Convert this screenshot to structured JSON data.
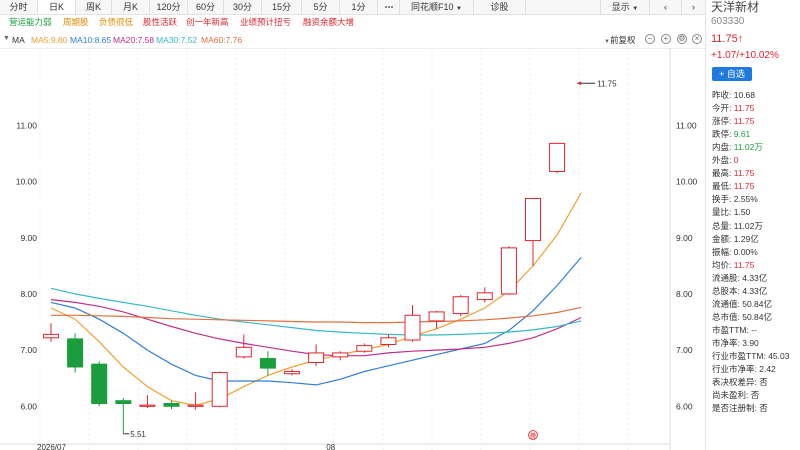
{
  "topbar": {
    "tabs": [
      "分时",
      "日K",
      "周K",
      "月K",
      "120分",
      "60分",
      "30分",
      "15分",
      "5分",
      "1分"
    ],
    "active_tab": "日K",
    "more_icon": "more-dots-icon",
    "f10": "同花顺F10",
    "diagnose": "诊股",
    "show": "显示"
  },
  "tags": [
    {
      "label": "营运能力弱",
      "color": "#1a9e3d"
    },
    {
      "label": "周期股",
      "color": "#e08a00"
    },
    {
      "label": "负债很低",
      "color": "#e08a00"
    },
    {
      "label": "股性活跃",
      "color": "#e0242d"
    },
    {
      "label": "创一年新高",
      "color": "#e0242d"
    },
    {
      "label": "业绩预计扭亏",
      "color": "#e0242d"
    },
    {
      "label": "融资余额大增",
      "color": "#e0242d"
    }
  ],
  "ma_row": {
    "ma": "MA",
    "ma5": "MA5:9.80",
    "ma10": "MA10:8.65",
    "ma20": "MA20:7.58",
    "ma30": "MA30:7.52",
    "ma60": "MA60:7.76",
    "adjust": "前复权",
    "colors": {
      "ma5": "#f0a030",
      "ma10": "#2f7fd6",
      "ma20": "#c0308a",
      "ma30": "#38b8c8",
      "ma60": "#e07040"
    }
  },
  "chart_data": {
    "type": "candlestick",
    "y_ticks": [
      "11.00",
      "10.00",
      "9.00",
      "8.00",
      "7.00",
      "6.00"
    ],
    "ylim": [
      5.4,
      12.2
    ],
    "x_labels": [
      {
        "index": 0,
        "label": "2026/07"
      },
      {
        "index": 12,
        "label": "08"
      }
    ],
    "candles": [
      {
        "open": 7.22,
        "close": 7.28,
        "high": 7.48,
        "low": 7.15
      },
      {
        "open": 7.2,
        "close": 6.7,
        "high": 7.3,
        "low": 6.6
      },
      {
        "open": 6.75,
        "close": 6.05,
        "high": 6.8,
        "low": 6.0
      },
      {
        "open": 6.1,
        "close": 6.05,
        "high": 6.15,
        "low": 5.51
      },
      {
        "open": 6.0,
        "close": 6.02,
        "high": 6.2,
        "low": 5.97
      },
      {
        "open": 6.05,
        "close": 6.0,
        "high": 6.1,
        "low": 5.95
      },
      {
        "open": 6.0,
        "close": 6.02,
        "high": 6.25,
        "low": 5.94
      },
      {
        "open": 6.0,
        "close": 6.6,
        "high": 6.62,
        "low": 5.98
      },
      {
        "open": 6.88,
        "close": 7.05,
        "high": 7.28,
        "low": 6.85
      },
      {
        "open": 6.85,
        "close": 6.68,
        "high": 6.98,
        "low": 6.55
      },
      {
        "open": 6.58,
        "close": 6.62,
        "high": 6.66,
        "low": 6.55
      },
      {
        "open": 6.78,
        "close": 6.95,
        "high": 7.1,
        "low": 6.72
      },
      {
        "open": 6.88,
        "close": 6.95,
        "high": 6.98,
        "low": 6.82
      },
      {
        "open": 6.98,
        "close": 7.08,
        "high": 7.12,
        "low": 6.95
      },
      {
        "open": 7.1,
        "close": 7.22,
        "high": 7.28,
        "low": 7.05
      },
      {
        "open": 7.18,
        "close": 7.62,
        "high": 7.8,
        "low": 7.15
      },
      {
        "open": 7.52,
        "close": 7.68,
        "high": 7.7,
        "low": 7.38
      },
      {
        "open": 7.65,
        "close": 7.95,
        "high": 7.98,
        "low": 7.6
      },
      {
        "open": 7.9,
        "close": 8.02,
        "high": 8.12,
        "low": 7.85
      },
      {
        "open": 8.0,
        "close": 8.82,
        "high": 8.85,
        "low": 7.98
      },
      {
        "open": 8.95,
        "close": 9.7,
        "high": 9.7,
        "low": 8.5
      },
      {
        "open": 10.18,
        "close": 10.68,
        "high": 10.68,
        "low": 10.15
      }
    ],
    "series": [
      {
        "name": "MA5",
        "color": "#f0a030",
        "values": [
          7.75,
          7.55,
          7.15,
          6.7,
          6.35,
          6.1,
          6.02,
          6.13,
          6.35,
          6.55,
          6.7,
          6.82,
          6.92,
          7.01,
          7.1,
          7.25,
          7.38,
          7.55,
          7.75,
          8.05,
          8.5,
          9.05,
          9.8
        ]
      },
      {
        "name": "MA10",
        "color": "#2f7fd6",
        "values": [
          7.85,
          7.75,
          7.55,
          7.3,
          7.0,
          6.75,
          6.55,
          6.45,
          6.45,
          6.45,
          6.42,
          6.38,
          6.48,
          6.62,
          6.72,
          6.82,
          6.92,
          7.02,
          7.12,
          7.35,
          7.7,
          8.15,
          8.65
        ]
      },
      {
        "name": "MA20",
        "color": "#c0308a",
        "values": [
          7.9,
          7.85,
          7.78,
          7.68,
          7.55,
          7.42,
          7.3,
          7.2,
          7.12,
          7.05,
          6.98,
          6.92,
          6.9,
          6.9,
          6.95,
          6.98,
          7.0,
          7.02,
          7.05,
          7.12,
          7.22,
          7.38,
          7.58
        ]
      },
      {
        "name": "MA30",
        "color": "#38b8c8",
        "values": [
          8.1,
          8.0,
          7.92,
          7.85,
          7.78,
          7.7,
          7.62,
          7.55,
          7.5,
          7.45,
          7.4,
          7.35,
          7.32,
          7.3,
          7.28,
          7.27,
          7.27,
          7.28,
          7.3,
          7.32,
          7.36,
          7.42,
          7.52
        ]
      },
      {
        "name": "MA60",
        "color": "#e07040",
        "values": [
          7.62,
          7.62,
          7.61,
          7.6,
          7.58,
          7.56,
          7.55,
          7.54,
          7.53,
          7.52,
          7.51,
          7.5,
          7.5,
          7.49,
          7.49,
          7.5,
          7.51,
          7.52,
          7.54,
          7.57,
          7.61,
          7.67,
          7.76
        ]
      }
    ],
    "annotations": {
      "high_label": "11.75",
      "low_label": "5.51",
      "marker": "榜"
    }
  },
  "panel": {
    "name": "天洋新材",
    "code": "603330",
    "price": "11.75↑",
    "change": "+1.07/+10.02%",
    "add_button": "+ 自选",
    "rows": [
      {
        "label": "昨收:",
        "value": "10.68",
        "tone": "neutral"
      },
      {
        "label": "今开:",
        "value": "11.75",
        "tone": "up"
      },
      {
        "label": "涨停:",
        "value": "11.75",
        "tone": "up"
      },
      {
        "label": "跌停:",
        "value": "9.61",
        "tone": "down"
      },
      {
        "label": "内盘:",
        "value": "11.02万",
        "tone": "down"
      },
      {
        "label": "外盘:",
        "value": "0",
        "tone": "up"
      },
      {
        "label": "最高:",
        "value": "11.75",
        "tone": "up"
      },
      {
        "label": "最低:",
        "value": "11.75",
        "tone": "up"
      },
      {
        "label": "换手:",
        "value": "2.55%",
        "tone": "neutral"
      },
      {
        "label": "量比:",
        "value": "1.50",
        "tone": "neutral"
      },
      {
        "label": "总量:",
        "value": "11.02万",
        "tone": "neutral"
      },
      {
        "label": "金额:",
        "value": "1.29亿",
        "tone": "neutral"
      },
      {
        "label": "振幅:",
        "value": "0.00%",
        "tone": "neutral"
      },
      {
        "label": "均价:",
        "value": "11.75",
        "tone": "up"
      },
      {
        "label": "流通股:",
        "value": "4.33亿",
        "tone": "neutral"
      },
      {
        "label": "总股本:",
        "value": "4.33亿",
        "tone": "neutral"
      },
      {
        "label": "流通值:",
        "value": "50.84亿",
        "tone": "neutral"
      },
      {
        "label": "总市值:",
        "value": "50.84亿",
        "tone": "neutral"
      },
      {
        "label": "市盈TTM:",
        "value": "--",
        "tone": "neutral"
      },
      {
        "label": "市净率:",
        "value": "3.90",
        "tone": "neutral"
      },
      {
        "label": "行业市盈TTM:",
        "value": "45.03",
        "tone": "neutral"
      },
      {
        "label": "行业市净率:",
        "value": "2.42",
        "tone": "neutral"
      },
      {
        "label": "表决权差异:",
        "value": "否",
        "tone": "neutral"
      },
      {
        "label": "尚未盈利:",
        "value": "否",
        "tone": "neutral"
      },
      {
        "label": "是否注册制:",
        "value": "否",
        "tone": "neutral"
      }
    ]
  }
}
